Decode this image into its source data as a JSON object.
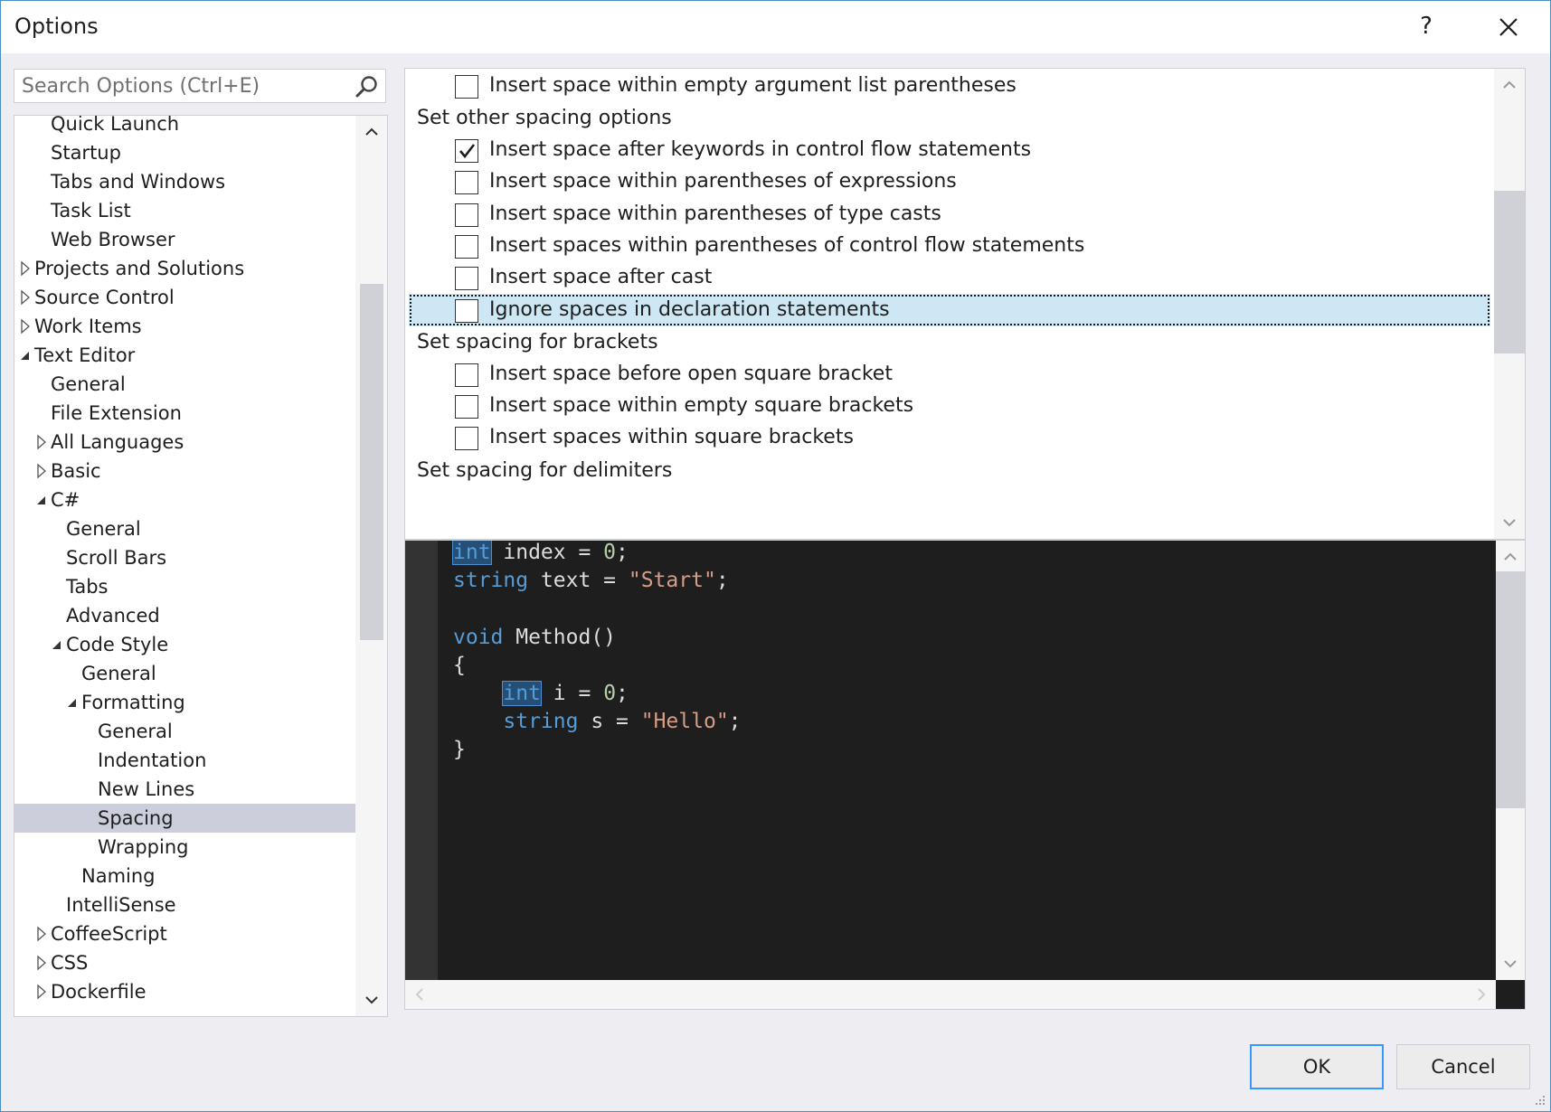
{
  "window": {
    "title": "Options",
    "help_label": "?"
  },
  "search": {
    "placeholder": "Search Options (Ctrl+E)",
    "value": ""
  },
  "tree": {
    "items": [
      {
        "label": "Quick Launch",
        "level": 2,
        "expander": "none"
      },
      {
        "label": "Startup",
        "level": 2,
        "expander": "none"
      },
      {
        "label": "Tabs and Windows",
        "level": 2,
        "expander": "none"
      },
      {
        "label": "Task List",
        "level": 2,
        "expander": "none"
      },
      {
        "label": "Web Browser",
        "level": 2,
        "expander": "none"
      },
      {
        "label": "Projects and Solutions",
        "level": 1,
        "expander": "collapsed"
      },
      {
        "label": "Source Control",
        "level": 1,
        "expander": "collapsed"
      },
      {
        "label": "Work Items",
        "level": 1,
        "expander": "collapsed"
      },
      {
        "label": "Text Editor",
        "level": 1,
        "expander": "expanded"
      },
      {
        "label": "General",
        "level": 2,
        "expander": "none"
      },
      {
        "label": "File Extension",
        "level": 2,
        "expander": "none"
      },
      {
        "label": "All Languages",
        "level": 2,
        "expander": "collapsed"
      },
      {
        "label": "Basic",
        "level": 2,
        "expander": "collapsed"
      },
      {
        "label": "C#",
        "level": 2,
        "expander": "expanded"
      },
      {
        "label": "General",
        "level": 3,
        "expander": "none"
      },
      {
        "label": "Scroll Bars",
        "level": 3,
        "expander": "none"
      },
      {
        "label": "Tabs",
        "level": 3,
        "expander": "none"
      },
      {
        "label": "Advanced",
        "level": 3,
        "expander": "none"
      },
      {
        "label": "Code Style",
        "level": 3,
        "expander": "expanded"
      },
      {
        "label": "General",
        "level": 4,
        "expander": "none"
      },
      {
        "label": "Formatting",
        "level": 4,
        "expander": "expanded"
      },
      {
        "label": "General",
        "level": 5,
        "expander": "none"
      },
      {
        "label": "Indentation",
        "level": 5,
        "expander": "none"
      },
      {
        "label": "New Lines",
        "level": 5,
        "expander": "none"
      },
      {
        "label": "Spacing",
        "level": 5,
        "expander": "none",
        "selected": true
      },
      {
        "label": "Wrapping",
        "level": 5,
        "expander": "none"
      },
      {
        "label": "Naming",
        "level": 4,
        "expander": "none"
      },
      {
        "label": "IntelliSense",
        "level": 3,
        "expander": "none"
      },
      {
        "label": "CoffeeScript",
        "level": 2,
        "expander": "collapsed"
      },
      {
        "label": "CSS",
        "level": 2,
        "expander": "collapsed"
      },
      {
        "label": "Dockerfile",
        "level": 2,
        "expander": "collapsed"
      }
    ]
  },
  "options": {
    "rows": [
      {
        "kind": "option",
        "label": "Insert space within empty argument list parentheses",
        "checked": false
      },
      {
        "kind": "header",
        "label": "Set other spacing options"
      },
      {
        "kind": "option",
        "label": "Insert space after keywords in control flow statements",
        "checked": true
      },
      {
        "kind": "option",
        "label": "Insert space within parentheses of expressions",
        "checked": false
      },
      {
        "kind": "option",
        "label": "Insert space within parentheses of type casts",
        "checked": false
      },
      {
        "kind": "option",
        "label": "Insert spaces within parentheses of control flow statements",
        "checked": false
      },
      {
        "kind": "option",
        "label": "Insert space after cast",
        "checked": false
      },
      {
        "kind": "option",
        "label": "Ignore spaces in declaration statements",
        "checked": false,
        "focused": true
      },
      {
        "kind": "header",
        "label": "Set spacing for brackets"
      },
      {
        "kind": "option",
        "label": "Insert space before open square bracket",
        "checked": false
      },
      {
        "kind": "option",
        "label": "Insert space within empty square brackets",
        "checked": false
      },
      {
        "kind": "option",
        "label": "Insert spaces within square brackets",
        "checked": false
      },
      {
        "kind": "header",
        "label": "Set spacing for delimiters"
      }
    ]
  },
  "preview": {
    "lines": [
      [
        {
          "t": "int",
          "c": "kw sel"
        },
        {
          "t": " index = "
        },
        {
          "t": "0",
          "c": "num"
        },
        {
          "t": ";"
        }
      ],
      [
        {
          "t": "string",
          "c": "kw"
        },
        {
          "t": " text = "
        },
        {
          "t": "\"Start\"",
          "c": "str"
        },
        {
          "t": ";"
        }
      ],
      [],
      [
        {
          "t": "void",
          "c": "kw"
        },
        {
          "t": " Method()"
        }
      ],
      [
        {
          "t": "{"
        }
      ],
      [
        {
          "t": "    "
        },
        {
          "t": "int",
          "c": "kw sel"
        },
        {
          "t": " i = "
        },
        {
          "t": "0",
          "c": "num"
        },
        {
          "t": ";"
        }
      ],
      [
        {
          "t": "    "
        },
        {
          "t": "string",
          "c": "kw"
        },
        {
          "t": " s = "
        },
        {
          "t": "\"Hello\"",
          "c": "str"
        },
        {
          "t": ";"
        }
      ],
      [
        {
          "t": "}"
        }
      ]
    ]
  },
  "buttons": {
    "ok_label": "OK",
    "cancel_label": "Cancel"
  },
  "colors": {
    "accent": "#3399ff",
    "selection": "#ccceDB",
    "focus_row": "#cde8f4",
    "editor_bg": "#1e1e1e",
    "keyword": "#569cd6",
    "string": "#d69d85",
    "number": "#b5cea8"
  },
  "icons": {
    "search": "magnifier-icon",
    "close": "close-icon",
    "checkbox_check": "checkmark-icon"
  }
}
